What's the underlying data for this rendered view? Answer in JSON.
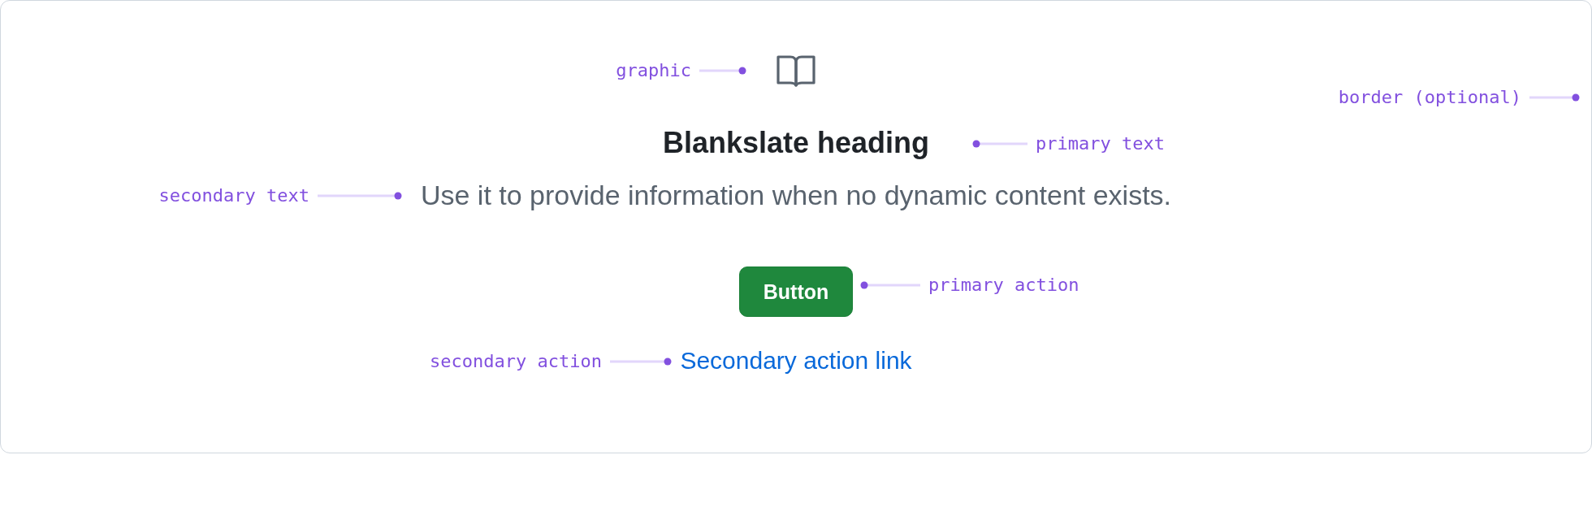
{
  "blankslate": {
    "heading": "Blankslate heading",
    "description": "Use it to provide information when no dynamic content exists.",
    "primary_action": "Button",
    "secondary_action": "Secondary action link"
  },
  "annotations": [
    {
      "label": "graphic",
      "kind": "left"
    },
    {
      "label": "border (optional)",
      "kind": "left"
    },
    {
      "label": "primary text",
      "kind": "right"
    },
    {
      "label": "secondary text",
      "kind": "left"
    },
    {
      "label": "primary action",
      "kind": "right"
    },
    {
      "label": "secondary action",
      "kind": "left"
    }
  ]
}
